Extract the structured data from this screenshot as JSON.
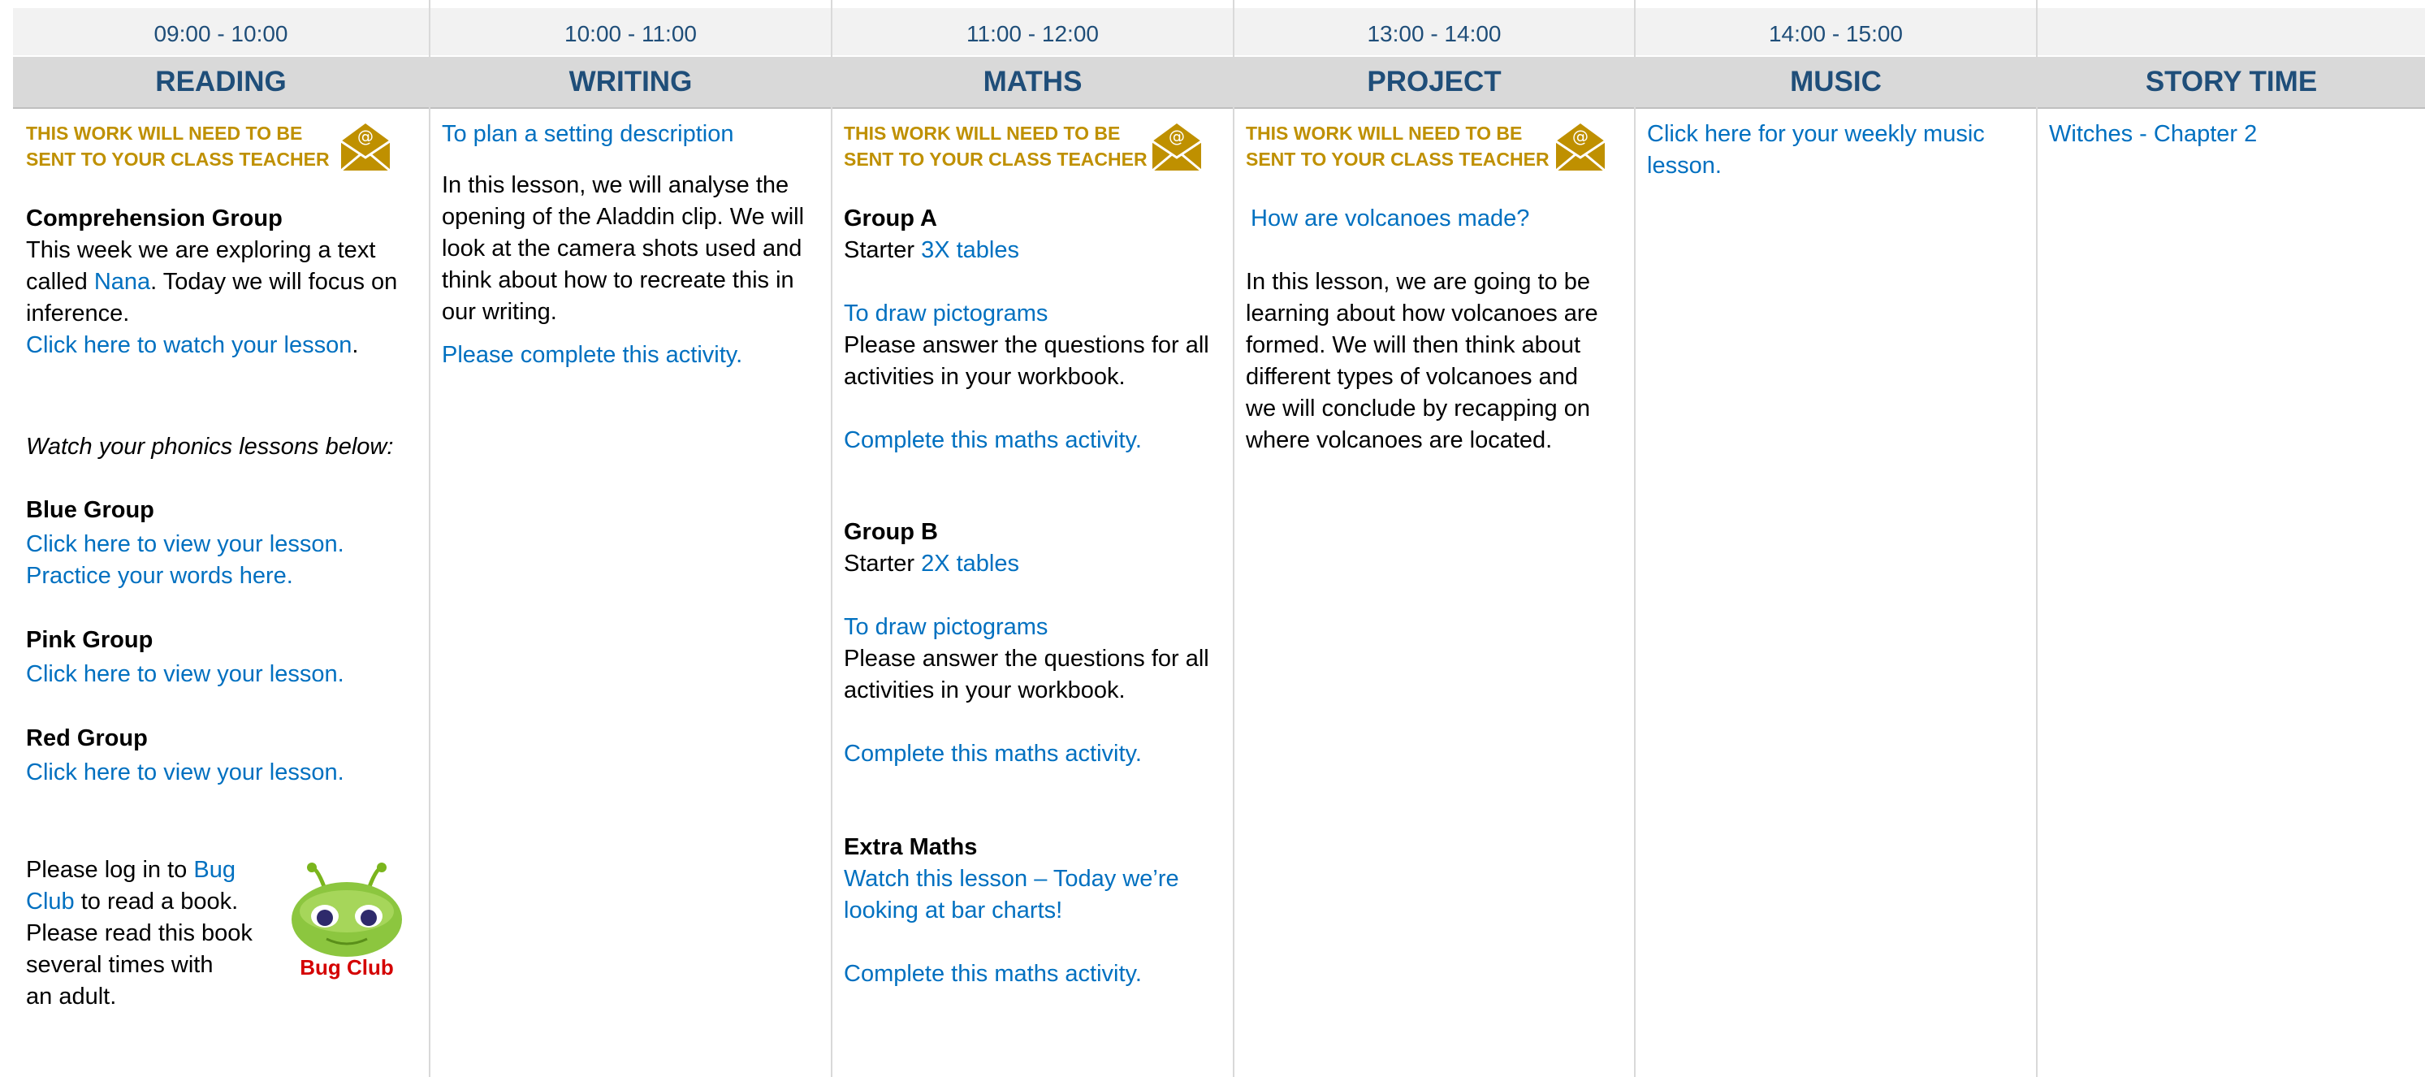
{
  "columns": [
    {
      "time": "09:00 - 10:00",
      "subject": "READING"
    },
    {
      "time": "10:00 - 11:00",
      "subject": "WRITING"
    },
    {
      "time": "11:00 - 12:00",
      "subject": "MATHS"
    },
    {
      "time": "13:00 - 14:00",
      "subject": "PROJECT"
    },
    {
      "time": "14:00 - 15:00",
      "subject": "MUSIC"
    },
    {
      "time": "",
      "subject": "STORY TIME"
    }
  ],
  "send_notice": {
    "line1": "THIS WORK WILL NEED TO BE",
    "line2": "SENT TO YOUR CLASS TEACHER"
  },
  "reading": {
    "comprehension_heading": "Comprehension Group",
    "intro_a": "This week we are exploring a text",
    "intro_b": "called ",
    "nana": "Nana",
    "intro_c": ". Today we will focus on",
    "intro_d": "inference.",
    "watch_link": "Click here to watch your lesson",
    "watch_dot": ".",
    "phonics": "Watch your phonics lessons below:",
    "blue_heading": "Blue Group",
    "blue_link1": "Click here to view your lesson.",
    "blue_link2": "Practice your words here.",
    "pink_heading": "Pink Group",
    "pink_link": "Click here to view your lesson.",
    "red_heading": "Red Group",
    "red_link": "Click here to view your lesson.",
    "bug_a": "Please log in to ",
    "bug_link1": "Bug",
    "bug_link2": "Club",
    "bug_b": " to read a book.",
    "bug_c": "Please read this book",
    "bug_d": "several times with",
    "bug_e": "an adult.",
    "bug_logo": "Bug Club"
  },
  "writing": {
    "title_link": "To plan a setting description",
    "p1": "In this lesson, we will analyse the",
    "p2": "opening of the Aladdin clip. We will",
    "p3": "look at the camera shots used and",
    "p4": "think about how to recreate this in",
    "p5": "our writing.",
    "activity_link": "Please complete this activity."
  },
  "maths": {
    "group_a": "Group A",
    "starter_label": "Starter ",
    "a_tables": "3X tables",
    "a_pictograms": "To draw pictograms",
    "a_q1": "Please answer the questions for all",
    "a_q2": "activities in your workbook.",
    "a_complete": "Complete this maths activity.",
    "group_b": "Group B",
    "b_tables": "2X tables",
    "b_pictograms": "To draw pictograms",
    "b_q1": "Please answer the questions for all",
    "b_q2": "activities in your workbook.",
    "b_complete": "Complete this maths activity.",
    "extra": "Extra Maths",
    "extra_link1": "Watch this lesson – Today we’re",
    "extra_link2": "looking at bar charts!",
    "extra_complete": "Complete this maths activity."
  },
  "project": {
    "question_link": "How are volcanoes made?",
    "p1": "In this lesson, we are going to be",
    "p2": "learning about how volcanoes are",
    "p3": "formed. We will then think about",
    "p4": "different types of volcanoes and",
    "p5": "we will conclude by recapping on",
    "p6": "where volcanoes are located."
  },
  "music": {
    "link1": "Click here for your weekly music",
    "link2": "lesson."
  },
  "story": {
    "link": "Witches - Chapter 2"
  },
  "colors": {
    "header_text": "#1f4e79",
    "link": "#0070c0",
    "notice": "#bf9000",
    "subject_bg": "#d9d9d9",
    "time_bg": "#f2f2f2"
  },
  "icons": [
    "envelope-at-icon",
    "bug-club-logo"
  ]
}
